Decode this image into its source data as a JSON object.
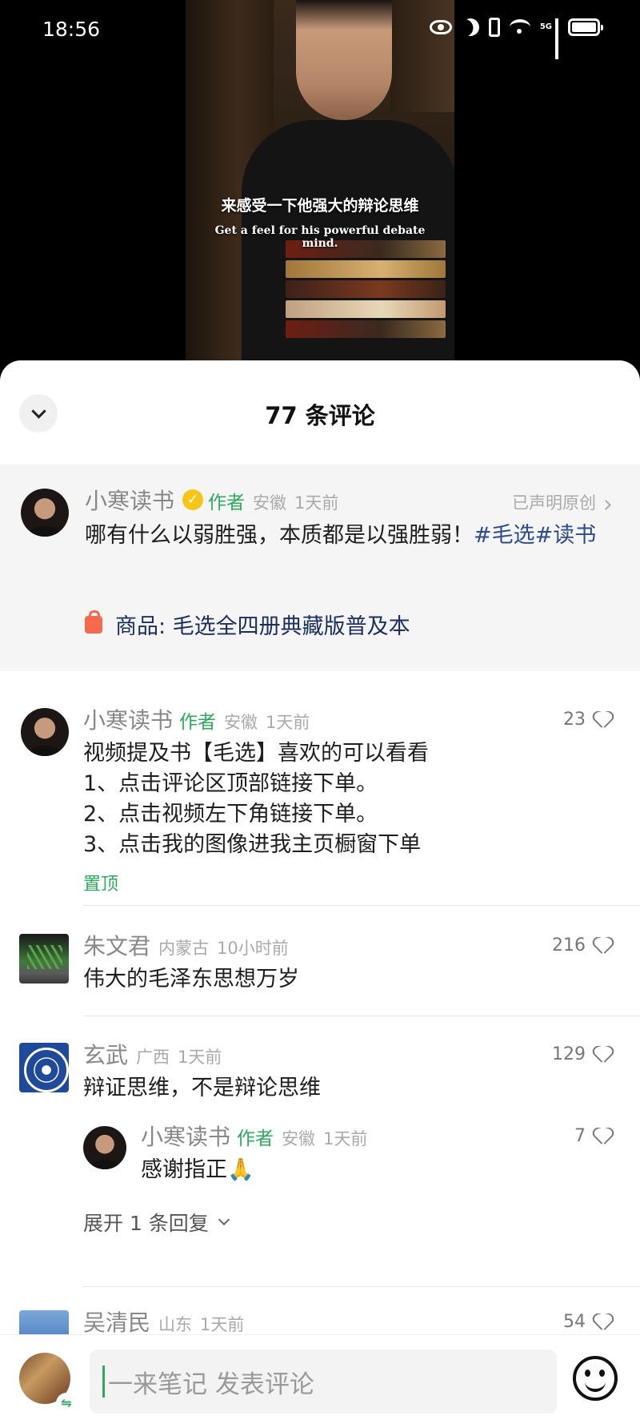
{
  "status_bar": {
    "time": "18:56",
    "network": "5G"
  },
  "video": {
    "subtitle_cn": "来感受一下他强大的辩论思维",
    "subtitle_en": "Get a feel for his powerful debate mind."
  },
  "sheet": {
    "title": "77 条评论"
  },
  "post": {
    "author": "小寒读书",
    "author_tag": "作者",
    "location": "安徽",
    "time": "1天前",
    "original_label": "已声明原创",
    "text": "哪有什么以弱胜强，本质都是以强胜弱！",
    "hashtags": "#毛选#读书",
    "product_label": "商品: 毛选全四册典藏版普及本"
  },
  "comments": [
    {
      "author": "小寒读书",
      "author_tag": "作者",
      "location": "安徽",
      "time": "1天前",
      "likes": "23",
      "lines": [
        "视频提及书【毛选】喜欢的可以看看",
        "1、点击评论区顶部链接下单。",
        "2、点击视频左下角链接下单。",
        "3、点击我的图像进我主页橱窗下单"
      ],
      "pinned_label": "置顶"
    },
    {
      "author": "朱文君",
      "location": "内蒙古",
      "time": "10小时前",
      "likes": "216",
      "text": "伟大的毛泽东思想万岁"
    },
    {
      "author": "玄武",
      "location": "广西",
      "time": "1天前",
      "likes": "129",
      "text": "辩证思维，不是辩论思维",
      "reply": {
        "author": "小寒读书",
        "author_tag": "作者",
        "location": "安徽",
        "time": "1天前",
        "likes": "7",
        "text": "感谢指正🙏"
      },
      "expand_label": "展开 1 条回复"
    },
    {
      "author": "吴清民",
      "location": "山东",
      "time": "1天前",
      "likes": "54"
    }
  ],
  "input": {
    "placeholder": "一来笔记 发表评论"
  },
  "colors": {
    "accent": "#2dab5c",
    "hashtag": "#2a4c8c",
    "product": "#1b2f5e",
    "bag": "#f56a4c"
  }
}
